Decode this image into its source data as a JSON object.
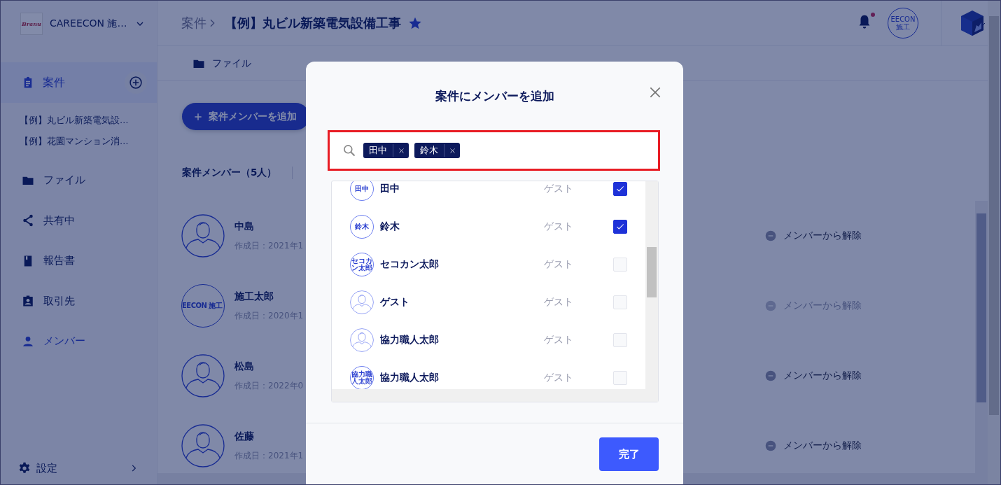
{
  "app": {
    "logo_text": "Branu",
    "org_name": "CAREECON 施…"
  },
  "sidebar": {
    "projects_label": "案件",
    "projects_selected": true,
    "projects": [
      "【例】丸ビル新築電気設…",
      "【例】花園マンション消…"
    ],
    "nav": [
      {
        "kind": "folder",
        "label": "ファイル",
        "selected": false
      },
      {
        "kind": "share",
        "label": "共有中",
        "selected": false
      },
      {
        "kind": "book",
        "label": "報告書",
        "selected": false
      },
      {
        "kind": "badge",
        "label": "取引先",
        "selected": false
      },
      {
        "kind": "person",
        "label": "メンバー",
        "selected": true
      }
    ],
    "settings_label": "設定"
  },
  "breadcrumb": {
    "parent": "案件",
    "current": "【例】丸ビル新築電気設備工事",
    "starred": true
  },
  "header": {
    "notification_unread": true,
    "company_avatar_text": "EECON 施工"
  },
  "tabs": [
    {
      "kind": "folder",
      "label": "ファイル"
    }
  ],
  "add_member_button": "案件メンバーを追加",
  "member_count": "案件メンバー（5人）",
  "members": [
    {
      "name": "中島",
      "date": "作成日：2021年1",
      "kind": "person",
      "remove_label": "メンバーから解除",
      "disabled": false
    },
    {
      "name": "施工太郎",
      "date": "作成日：2020年1",
      "kind": "logo",
      "avatar_text": "EECON 施工",
      "remove_label": "メンバーから解除",
      "disabled": true
    },
    {
      "name": "松島",
      "date": "作成日：2022年0",
      "kind": "person",
      "remove_label": "メンバーから解除",
      "disabled": false
    },
    {
      "name": "佐藤",
      "date": "作成日：2021年1",
      "kind": "person",
      "remove_label": "メンバーから解除",
      "disabled": false
    }
  ],
  "modal": {
    "title": "案件にメンバーを追加",
    "chips": [
      "田中",
      "鈴木"
    ],
    "members": [
      {
        "name": "田中",
        "role": "ゲスト",
        "kind": "text",
        "avatar_text": "田中",
        "checked": true
      },
      {
        "name": "鈴木",
        "role": "ゲスト",
        "kind": "text",
        "avatar_text": "鈴木",
        "checked": true
      },
      {
        "name": "セコカン太郎",
        "role": "ゲスト",
        "kind": "text",
        "avatar_text": "セコカン太郎",
        "checked": false
      },
      {
        "name": "ゲスト",
        "role": "ゲスト",
        "kind": "person",
        "checked": false
      },
      {
        "name": "協力職人太郎",
        "role": "ゲスト",
        "kind": "person",
        "checked": false
      },
      {
        "name": "協力職人太郎",
        "role": "ゲスト",
        "kind": "text",
        "avatar_text": "協力職人太郎",
        "checked": false
      }
    ],
    "done_button": "完了"
  }
}
